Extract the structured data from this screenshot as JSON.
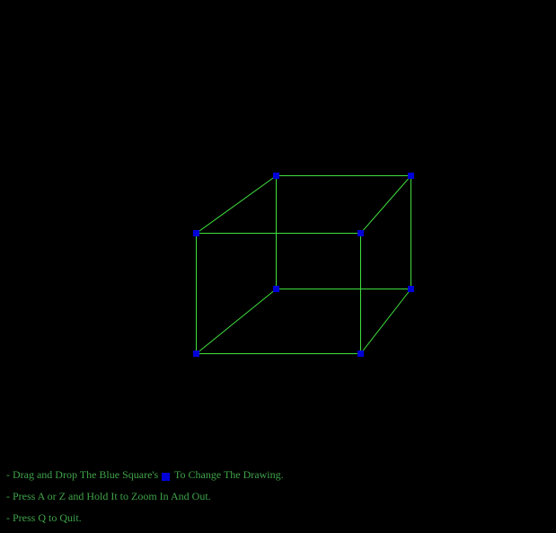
{
  "colors": {
    "background": "#000000",
    "edge": "#3fe03f",
    "handle": "#0000d8",
    "text": "#3fa44a"
  },
  "cube": {
    "vertices": [
      {
        "id": "front-top-left"
      },
      {
        "id": "front-top-right"
      },
      {
        "id": "front-bottom-left"
      },
      {
        "id": "front-bottom-right"
      },
      {
        "id": "back-top-left"
      },
      {
        "id": "back-top-right"
      },
      {
        "id": "back-bottom-left"
      },
      {
        "id": "back-bottom-right"
      }
    ]
  },
  "instructions": {
    "line1_prefix": "- Drag and Drop The Blue Square's",
    "line1_suffix": "To Change The Drawing.",
    "line2": "- Press A or Z and Hold It to Zoom In And Out.",
    "line3": "- Press Q to Quit."
  }
}
